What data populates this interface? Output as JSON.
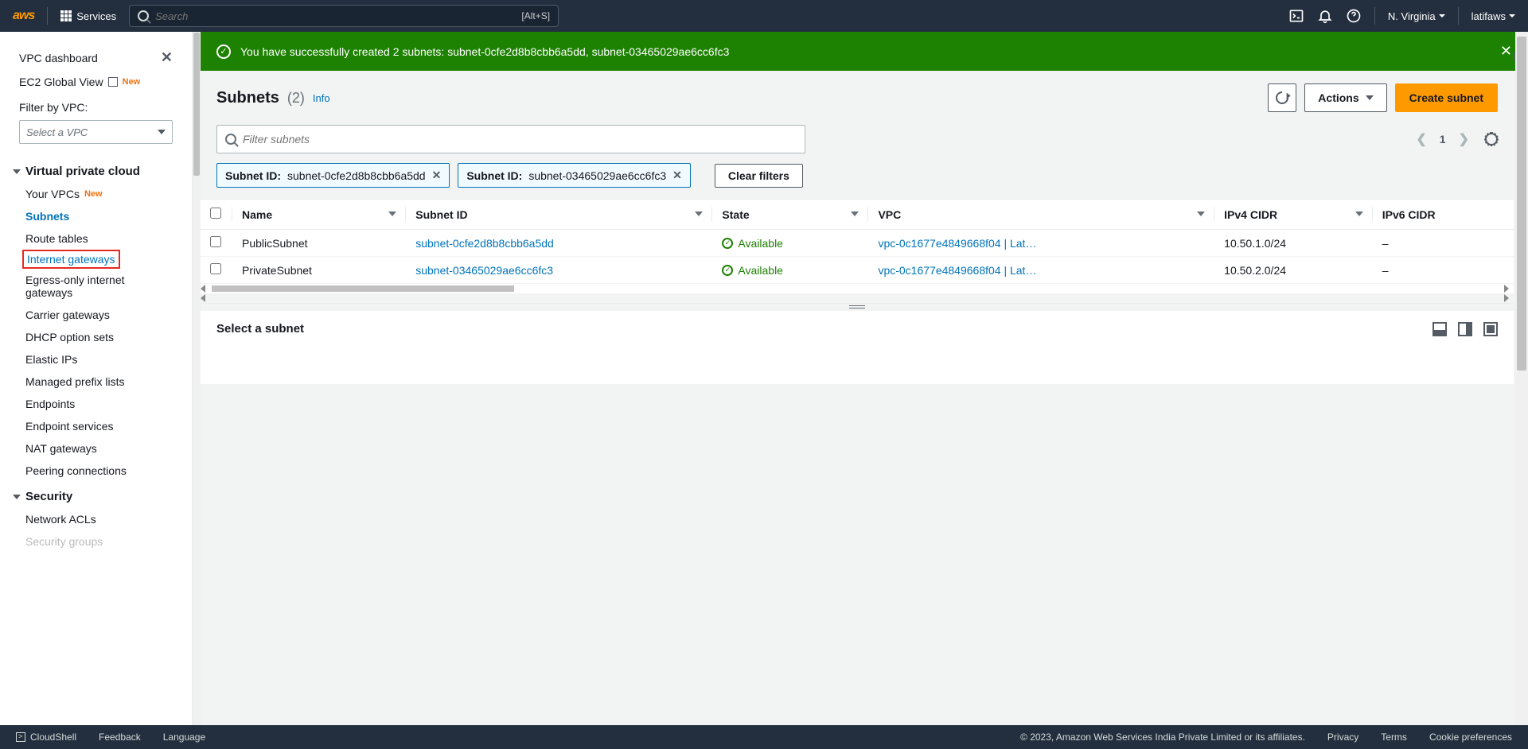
{
  "topnav": {
    "logo": "aws",
    "services_label": "Services",
    "search_placeholder": "Search",
    "search_shortcut": "[Alt+S]",
    "region": "N. Virginia",
    "user": "latifaws"
  },
  "sidebar": {
    "dashboard": "VPC dashboard",
    "ec2_global": "EC2 Global View",
    "filter_label": "Filter by VPC:",
    "vpc_select_placeholder": "Select a VPC",
    "group_vpc": "Virtual private cloud",
    "group_security": "Security",
    "new_label": "New",
    "vpc_items": [
      {
        "label": "Your VPCs",
        "new": true
      },
      {
        "label": "Subnets",
        "active": true
      },
      {
        "label": "Route tables"
      },
      {
        "label": "Internet gateways",
        "highlighted": true
      },
      {
        "label": "Egress-only internet gateways"
      },
      {
        "label": "Carrier gateways"
      },
      {
        "label": "DHCP option sets"
      },
      {
        "label": "Elastic IPs"
      },
      {
        "label": "Managed prefix lists"
      },
      {
        "label": "Endpoints"
      },
      {
        "label": "Endpoint services"
      },
      {
        "label": "NAT gateways"
      },
      {
        "label": "Peering connections"
      }
    ],
    "security_items": [
      {
        "label": "Network ACLs"
      },
      {
        "label": "Security groups"
      }
    ]
  },
  "banner": {
    "message": "You have successfully created 2 subnets: subnet-0cfe2d8b8cbb6a5dd, subnet-03465029ae6cc6fc3"
  },
  "header": {
    "title": "Subnets",
    "count": "(2)",
    "info": "Info",
    "actions_label": "Actions",
    "create_label": "Create subnet"
  },
  "filter": {
    "placeholder": "Filter subnets",
    "page": "1",
    "tags": [
      {
        "key": "Subnet ID:",
        "value": "subnet-0cfe2d8b8cbb6a5dd"
      },
      {
        "key": "Subnet ID:",
        "value": "subnet-03465029ae6cc6fc3"
      }
    ],
    "clear_label": "Clear filters"
  },
  "table": {
    "columns": [
      "Name",
      "Subnet ID",
      "State",
      "VPC",
      "IPv4 CIDR",
      "IPv6 CIDR"
    ],
    "rows": [
      {
        "name": "PublicSubnet",
        "subnet_id": "subnet-0cfe2d8b8cbb6a5dd",
        "state": "Available",
        "vpc": "vpc-0c1677e4849668f04 | Lat…",
        "ipv4": "10.50.1.0/24",
        "ipv6": "–"
      },
      {
        "name": "PrivateSubnet",
        "subnet_id": "subnet-03465029ae6cc6fc3",
        "state": "Available",
        "vpc": "vpc-0c1677e4849668f04 | Lat…",
        "ipv4": "10.50.2.0/24",
        "ipv6": "–"
      }
    ]
  },
  "detail": {
    "title": "Select a subnet"
  },
  "footer": {
    "cloudshell": "CloudShell",
    "feedback": "Feedback",
    "language": "Language",
    "copyright": "© 2023, Amazon Web Services India Private Limited or its affiliates.",
    "privacy": "Privacy",
    "terms": "Terms",
    "cookies": "Cookie preferences"
  }
}
